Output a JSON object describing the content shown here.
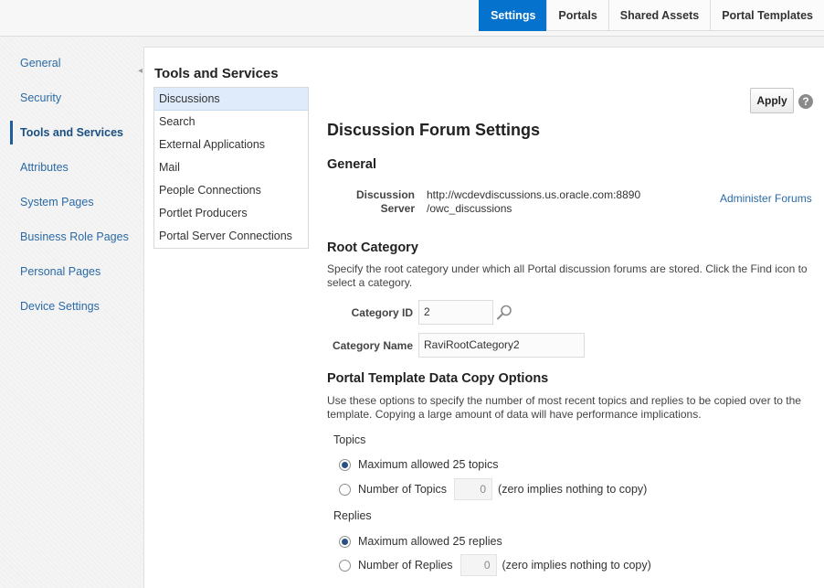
{
  "tabs": [
    {
      "label": "Settings",
      "active": true
    },
    {
      "label": "Portals",
      "active": false
    },
    {
      "label": "Shared Assets",
      "active": false
    },
    {
      "label": "Portal Templates",
      "active": false
    }
  ],
  "sidebar": {
    "items": [
      {
        "label": "General"
      },
      {
        "label": "Security"
      },
      {
        "label": "Tools and Services",
        "active": true
      },
      {
        "label": "Attributes"
      },
      {
        "label": "System Pages"
      },
      {
        "label": "Business Role Pages"
      },
      {
        "label": "Personal Pages"
      },
      {
        "label": "Device Settings"
      }
    ],
    "collapse_icon": "chevron-left-icon"
  },
  "tools": {
    "title": "Tools and Services",
    "services": [
      {
        "label": "Discussions",
        "selected": true
      },
      {
        "label": "Search"
      },
      {
        "label": "External Applications"
      },
      {
        "label": "Mail"
      },
      {
        "label": "People Connections"
      },
      {
        "label": "Portlet Producers"
      },
      {
        "label": "Portal Server Connections"
      }
    ]
  },
  "toolbar": {
    "apply_label": "Apply",
    "help_icon": "help-icon"
  },
  "form": {
    "title": "Discussion Forum Settings",
    "general": {
      "heading": "General",
      "server_label_line1": "Discussion",
      "server_label_line2": "Server",
      "server_url_line1": "http://wcdevdiscussions.us.oracle.com:8890",
      "server_url_line2": "/owc_discussions",
      "admin_link": "Administer Forums"
    },
    "root_category": {
      "heading": "Root Category",
      "description": "Specify the root category under which all Portal discussion forums are stored. Click the Find icon to select a category.",
      "category_id_label": "Category ID",
      "category_id_value": "2",
      "category_name_label": "Category Name",
      "category_name_value": "RaviRootCategory2",
      "find_icon": "search-icon"
    },
    "copy_options": {
      "heading": "Portal Template Data Copy Options",
      "description": "Use these options to specify the number of most recent topics and replies to be copied over to the template. Copying a large amount of data will have performance implications.",
      "topics_label": "Topics",
      "topics_max_option": "Maximum allowed 25 topics",
      "topics_num_option": "Number of Topics",
      "topics_num_value": "0",
      "topics_hint": "(zero implies nothing to copy)",
      "topics_selected": "max",
      "replies_label": "Replies",
      "replies_max_option": "Maximum allowed 25 replies",
      "replies_num_option": "Number of Replies",
      "replies_num_value": "0",
      "replies_hint": "(zero implies nothing to copy)",
      "replies_selected": "max"
    }
  },
  "colors": {
    "accent": "#0572ce",
    "link": "#2b6aa6",
    "selected_row": "#dfeafb"
  }
}
